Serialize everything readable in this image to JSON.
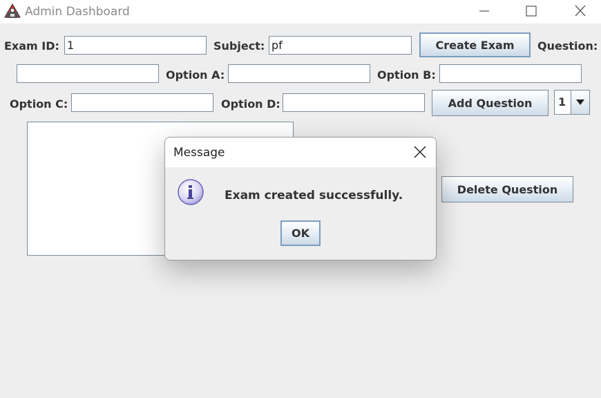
{
  "window": {
    "title": "Admin Dashboard"
  },
  "form": {
    "exam_id_label": "Exam ID:",
    "exam_id_value": "1",
    "subject_label": "Subject:",
    "subject_value": "pf",
    "create_exam_label": "Create Exam",
    "question_label": "Question:",
    "question_value": "",
    "option_a_label": "Option A:",
    "option_a_value": "",
    "option_b_label": "Option B:",
    "option_b_value": "",
    "option_c_label": "Option C:",
    "option_c_value": "",
    "option_d_label": "Option D:",
    "option_d_value": "",
    "add_question_label": "Add Question",
    "answer_select_value": "1",
    "delete_question_label": "Delete Question"
  },
  "dialog": {
    "title": "Message",
    "message": "Exam created successfully.",
    "ok_label": "OK",
    "icon": "info-icon"
  }
}
